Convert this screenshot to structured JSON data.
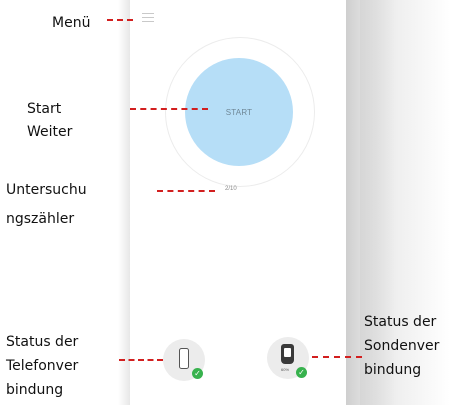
{
  "annotations": {
    "menu": "Menü",
    "start_1": "Start",
    "start_2": "Weiter",
    "counter_1": "Untersuchu",
    "counter_2": "ngszähler",
    "phone_status_1": "Status der",
    "phone_status_2": "Telefonver",
    "phone_status_3": "bindung",
    "probe_status_1": "Status der",
    "probe_status_2": "Sondenver",
    "probe_status_3": "bindung"
  },
  "app": {
    "menu_icon": "hamburger-menu-icon",
    "start_button_label": "START",
    "exam_counter": "2/10",
    "probe_battery": "60%",
    "status_color": "#37b24d",
    "start_button_color": "#b6def7"
  }
}
